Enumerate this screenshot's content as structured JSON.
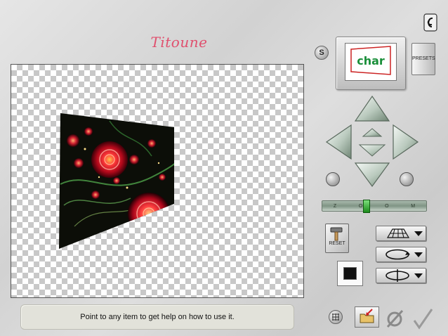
{
  "app": {
    "title": "Titoune"
  },
  "help": {
    "text": "Point to any item to get help on how to use it."
  },
  "preview": {
    "thumbnail_text": "char"
  },
  "buttons": {
    "s_label": "S",
    "presets_label": "PRESETS",
    "reset_label": "RESET"
  },
  "slider": {
    "tick_labels": [
      "Z",
      "O",
      "O",
      "M"
    ],
    "value_fraction": 0.42
  },
  "icons": {
    "corner": "corel-logo-icon",
    "up": "arrow-up-icon",
    "down": "arrow-down-icon",
    "left": "arrow-left-icon",
    "right": "arrow-right-icon",
    "forward": "move-forward-icon",
    "backward": "move-backward-icon",
    "rotate_left": "rotate-left-icon",
    "rotate_right": "rotate-right-icon",
    "perspective": "perspective-grid-icon",
    "rotate_x": "rotate-horizontal-icon",
    "rotate_y": "rotate-vertical-icon",
    "grid": "grid-icon",
    "load": "open-folder-icon",
    "cancel": "cancel-icon",
    "ok": "checkmark-icon"
  },
  "colors": {
    "title": "#e0506e",
    "arrow_fill": "#c9d6cc",
    "slider_thumb": "#2fbf2f"
  }
}
